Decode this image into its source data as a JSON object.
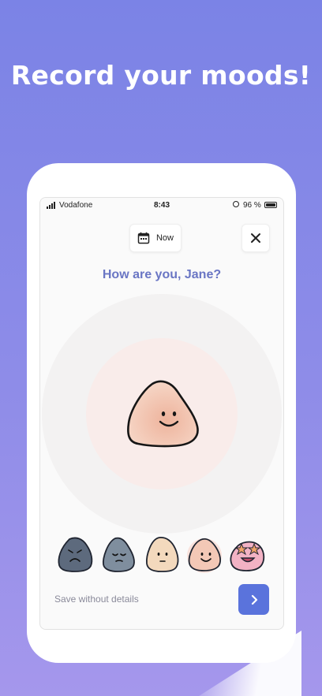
{
  "headline": "Record your moods!",
  "status_bar": {
    "carrier": "Vodafone",
    "time": "8:43",
    "battery": "96 %"
  },
  "header": {
    "date_button": {
      "label": "Now",
      "icon": "calendar-icon"
    },
    "close_button": {
      "icon": "close-icon"
    }
  },
  "question": "How are you, Jane?",
  "mood_scale": {
    "selected_index": 3,
    "options": [
      {
        "icon": "very-sad-face-icon",
        "color": "#5d6a7d"
      },
      {
        "icon": "sad-face-icon",
        "color": "#7f8e9e"
      },
      {
        "icon": "neutral-face-icon",
        "color": "#f3d9bd"
      },
      {
        "icon": "happy-face-icon",
        "color": "#f3c8b6"
      },
      {
        "icon": "ecstatic-face-icon",
        "color": "#f2b2c4"
      }
    ]
  },
  "footer": {
    "save_link": "Save without details",
    "next_button": {
      "icon": "chevron-right-icon"
    }
  },
  "colors": {
    "accent": "#5a73dc",
    "question_text": "#6a76c4",
    "background_top": "#7b83e6",
    "background_bottom": "#a597ec"
  }
}
